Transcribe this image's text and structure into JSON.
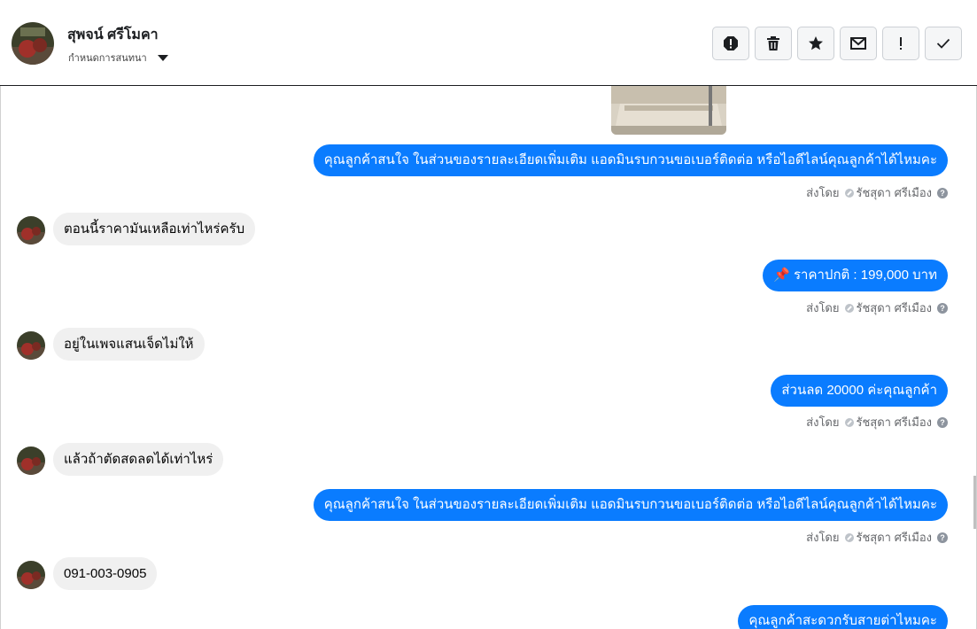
{
  "header": {
    "contact_name": "สุพจน์ ศรีโมคา",
    "assign_label": "กำหนดการสนทนา",
    "actions": [
      {
        "name": "report-spam-icon"
      },
      {
        "name": "trash-icon"
      },
      {
        "name": "star-icon"
      },
      {
        "name": "envelope-icon"
      },
      {
        "name": "exclamation-icon"
      },
      {
        "name": "checkmark-icon"
      }
    ]
  },
  "thread": {
    "messages": [
      {
        "dir": "out",
        "text": "คุณลูกค้าสนใจ ในส่วนของรายละเอียดเพิ่มเติม แอดมินรบกวนขอเบอร์ติดต่อ หรือไอดีไลน์คุณลูกค้าได้ไหมคะ",
        "sent_by_label": "ส่งโดย",
        "sender": "รัชสุดา ศรีเมือง"
      },
      {
        "dir": "in",
        "text": "ตอนนี้ราคามันเหลือเท่าไหร่ครับ"
      },
      {
        "dir": "out",
        "text": "📌 ราคาปกติ : 199,000 บาท",
        "sent_by_label": "ส่งโดย",
        "sender": "รัชสุดา ศรีเมือง"
      },
      {
        "dir": "in",
        "text": "อยู่ในเพจแสนเจ็ดไม่ให้"
      },
      {
        "dir": "out",
        "text": "ส่วนลด 20000 ค่ะคุณลูกค้า",
        "sent_by_label": "ส่งโดย",
        "sender": "รัชสุดา ศรีเมือง"
      },
      {
        "dir": "in",
        "text": "แล้วถ้าตัดสดลดได้เท่าไหร่"
      },
      {
        "dir": "out",
        "text": "คุณลูกค้าสนใจ ในส่วนของรายละเอียดเพิ่มเติม แอดมินรบกวนขอเบอร์ติดต่อ หรือไอดีไลน์คุณลูกค้าได้ไหมคะ",
        "sent_by_label": "ส่งโดย",
        "sender": "รัชสุดา ศรีเมือง"
      },
      {
        "dir": "in",
        "text": "091-003-0905"
      },
      {
        "dir": "out",
        "text": "คุณลูกค้าสะดวกรับสายต่าไหมคะ"
      }
    ]
  },
  "colors": {
    "outgoing_bubble": "#0a7cff",
    "incoming_bubble": "#f0f0f0",
    "meta_text": "#65676b"
  }
}
